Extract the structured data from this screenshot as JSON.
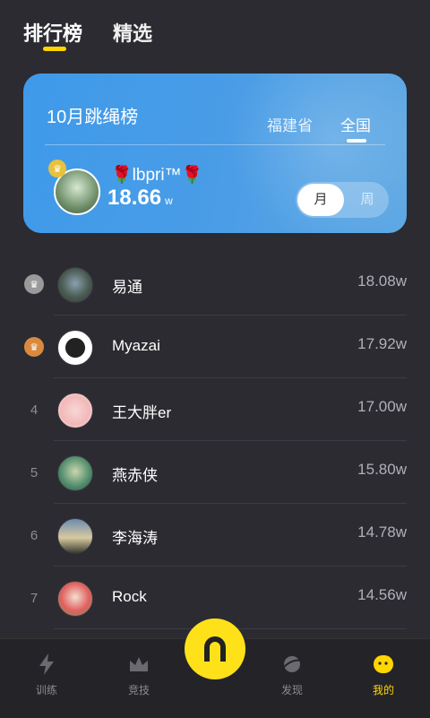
{
  "top_tabs": {
    "active": "排行榜",
    "inactive": "精选"
  },
  "banner": {
    "title": "10月跳绳榜",
    "regions": [
      "福建省",
      "全国"
    ],
    "me": {
      "name": "🌹lbpri™🌹",
      "score": "18.66",
      "unit": "w"
    },
    "period": {
      "on": "月",
      "off": "周"
    }
  },
  "leaderboard": [
    {
      "rank": "",
      "badge": "silver",
      "name": "易通",
      "score": "18.08w"
    },
    {
      "rank": "",
      "badge": "bronze",
      "name": "Myazai",
      "score": "17.92w"
    },
    {
      "rank": "4",
      "badge": "",
      "name": "王大胖er",
      "score": "17.00w"
    },
    {
      "rank": "5",
      "badge": "",
      "name": "燕赤侠",
      "score": "15.80w"
    },
    {
      "rank": "6",
      "badge": "",
      "name": "李海涛",
      "score": "14.78w"
    },
    {
      "rank": "7",
      "badge": "",
      "name": "Rock",
      "score": "14.56w"
    }
  ],
  "bottom_nav": {
    "train": "训练",
    "compete": "竞技",
    "discover": "发现",
    "mine": "我的"
  },
  "colors": {
    "accent": "#ffd600",
    "banner": "#3f9aea",
    "background": "#2b2b31"
  }
}
